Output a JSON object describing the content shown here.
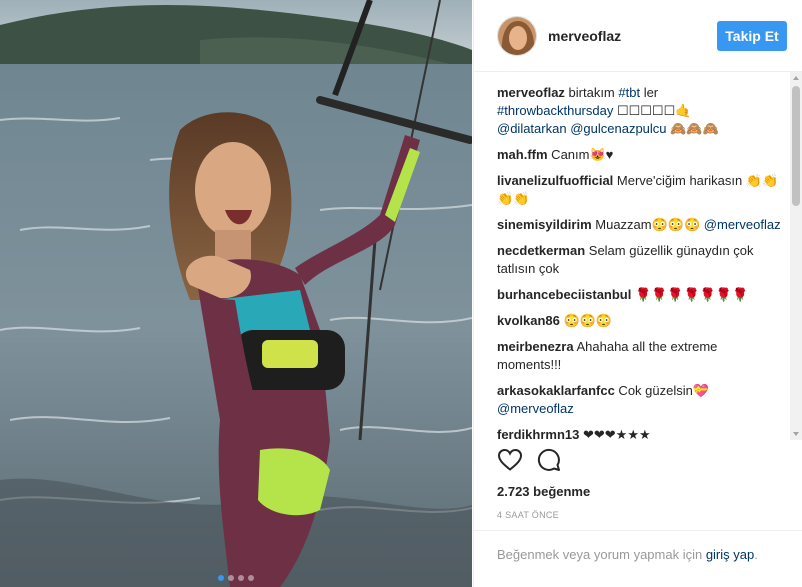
{
  "post": {
    "username": "merveoflaz",
    "follow_label": "Takip Et",
    "likes_text": "2.723 beğenme",
    "time_text": "4 SAAT ÖNCE",
    "footer": {
      "text": "Beğenmek veya yorum yapmak için ",
      "link": "giriş yap",
      "end": "."
    },
    "carousel_slides": 4,
    "carousel_active": 1
  },
  "caption": {
    "user": "merveoflaz",
    "text_1": " birtakım ",
    "tag_1": "#tbt",
    "text_2": " ler ",
    "tag_2": "#throwbackthursday",
    "text_3": " ☐☐☐☐☐🤙 ",
    "mention_1": "@dilatarkan",
    "text_4": " ",
    "mention_2": "@gulcenazpulcu",
    "text_5": " 🙈🙈🙈"
  },
  "comments": [
    {
      "user": "mah.ffm",
      "text": " Canım😻♥",
      "mention": ""
    },
    {
      "user": "livanelizulfuofficial",
      "text": " Merve'ciğim harikasın 👏👏👏👏",
      "mention": ""
    },
    {
      "user": "sinemisyildirim",
      "text": " Muazzam😳😳😳 ",
      "mention": "@merveoflaz"
    },
    {
      "user": "necdetkerman",
      "text": " Selam güzellik günaydın çok tatlısın çok",
      "mention": ""
    },
    {
      "user": "burhancebeciistanbul",
      "text": " 🌹🌹🌹🌹🌹🌹🌹",
      "mention": ""
    },
    {
      "user": "kvolkan86",
      "text": " 😳😳😳",
      "mention": ""
    },
    {
      "user": "meirbenezra",
      "text": " Ahahaha all the extreme moments!!!",
      "mention": ""
    },
    {
      "user": "arkasokaklarfanfcc",
      "text": " Cok güzelsin💝 ",
      "mention": "@merveoflaz"
    },
    {
      "user": "ferdikhrmn13",
      "text": " ❤❤❤★★★",
      "mention": ""
    }
  ],
  "colors": {
    "accent": "#3897f0",
    "link": "#003569",
    "muted": "#999999",
    "text": "#262626"
  },
  "icons": [
    "heart-icon",
    "comment-icon"
  ]
}
